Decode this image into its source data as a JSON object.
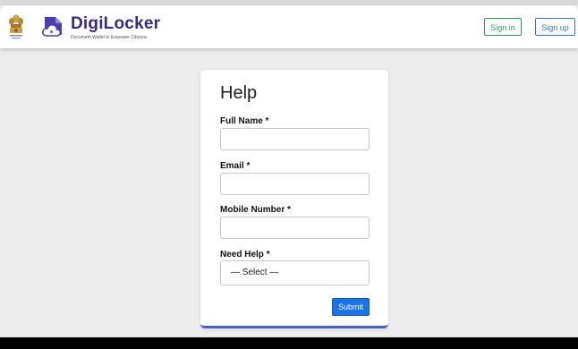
{
  "header": {
    "brand_name": "DigiLocker",
    "brand_tagline": "Document Wallet to Empower Citizens",
    "sign_in_label": "Sign in",
    "sign_up_label": "Sign up"
  },
  "help_form": {
    "title": "Help",
    "fields": [
      {
        "label": "Full Name *",
        "value": "",
        "placeholder": ""
      },
      {
        "label": "Email *",
        "value": "",
        "placeholder": ""
      },
      {
        "label": "Mobile Number *",
        "value": "",
        "placeholder": ""
      }
    ],
    "need_help": {
      "label": "Need Help *",
      "selected": "— Select —"
    },
    "submit_label": "Submit"
  },
  "colors": {
    "brand": "#3a2b86",
    "sign_in": "#2e9e5b",
    "sign_up": "#3b74c9",
    "submit": "#1a73e8",
    "card_accent": "#4a5fc1"
  },
  "icons": [
    "national-emblem-icon",
    "digilocker-logo-icon"
  ]
}
